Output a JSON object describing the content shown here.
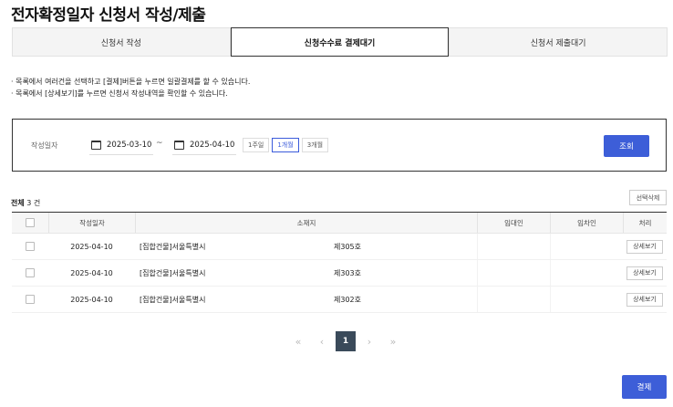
{
  "page": {
    "title": "전자확정일자 신청서 작성/제출"
  },
  "tabs": [
    {
      "label": "신청서 작성",
      "active": false
    },
    {
      "label": "신청수수료 결제대기",
      "active": true
    },
    {
      "label": "신청서 제출대기",
      "active": false
    }
  ],
  "notices": [
    "· 목록에서 여러건을 선택하고 [결제]버튼을 누르면 일괄결제를 할 수 있습니다.",
    "· 목록에서 [상세보기]를 누르면 신청서 작성내역을 확인할 수 있습니다."
  ],
  "search": {
    "label": "작성일자",
    "date_from": "2025-03-10",
    "date_to": "2025-04-10",
    "separator": "~",
    "ranges": [
      {
        "label": "1주일",
        "active": false
      },
      {
        "label": "1개월",
        "active": true
      },
      {
        "label": "3개월",
        "active": false
      }
    ],
    "search_label": "조회"
  },
  "summary": {
    "prefix": "전체",
    "count": "3",
    "suffix": "건"
  },
  "delete_label": "선택삭제",
  "table": {
    "headers": {
      "date": "작성일자",
      "address": "소재지",
      "owner": "임대인",
      "tenant": "임차인",
      "action": "처리"
    },
    "rows": [
      {
        "date": "2025-04-10",
        "address": "[집합건물]서울특별시",
        "unit": "제305호",
        "owner": "",
        "tenant": "",
        "action": "상세보기"
      },
      {
        "date": "2025-04-10",
        "address": "[집합건물]서울특별시",
        "unit": "제303호",
        "owner": "",
        "tenant": "",
        "action": "상세보기"
      },
      {
        "date": "2025-04-10",
        "address": "[집합건물]서울특별시",
        "unit": "제302호",
        "owner": "",
        "tenant": "",
        "action": "상세보기"
      }
    ]
  },
  "pagination": {
    "first": "«",
    "prev": "‹",
    "current": "1",
    "next": "›",
    "last": "»"
  },
  "pay_label": "결제"
}
